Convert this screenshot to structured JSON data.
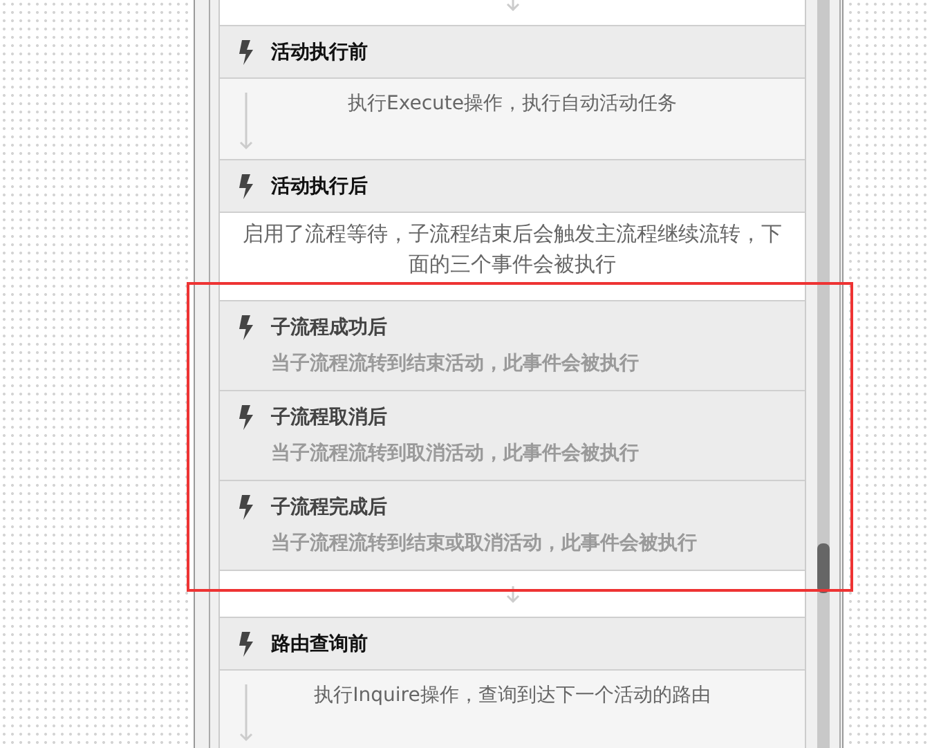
{
  "blocks": [
    {
      "kind": "connector"
    },
    {
      "kind": "stage",
      "title": "活动执行前"
    },
    {
      "kind": "step",
      "text": "执行Execute操作，执行自动活动任务"
    },
    {
      "kind": "stage",
      "title": "活动执行后"
    },
    {
      "kind": "note",
      "text": "启用了流程等待，子流程结束后会触发主流程继续流转，下面的三个事件会被执行"
    },
    {
      "kind": "event",
      "title": "子流程成功后",
      "text": "当子流程流转到结束活动，此事件会被执行"
    },
    {
      "kind": "event",
      "title": "子流程取消后",
      "text": "当子流程流转到取消活动，此事件会被执行"
    },
    {
      "kind": "event",
      "title": "子流程完成后",
      "text": "当子流程流转到结束或取消活动，此事件会被执行"
    },
    {
      "kind": "connector"
    },
    {
      "kind": "stage",
      "title": "路由查询前"
    },
    {
      "kind": "step",
      "text": "执行Inquire操作，查询到达下一个活动的路由"
    }
  ],
  "highlight_frame": true
}
